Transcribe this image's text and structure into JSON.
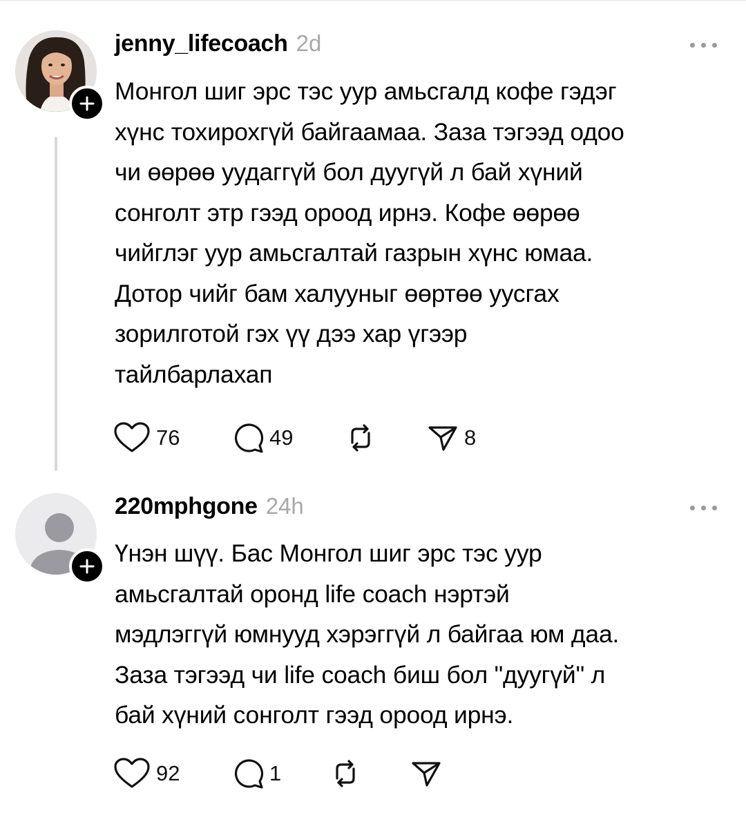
{
  "posts": [
    {
      "username": "jenny_lifecoach",
      "time": "2d",
      "text": "Монгол шиг эрс тэс уур амьсгалд кофе гэдэг\nхүнс тохирохгүй байгаамаа. Заза тэгээд одоо\nчи өөрөө уудаггүй бол дуугүй л бай хүний\nсонголт этр гээд ороод ирнэ. Кофе өөрөө\nчийглэг уур амьсгалтай газрын хүнс юмаа.\nДотор чийг бам халууныг өөртөө уусгах\nзорилготой гэх үү дээ хар үгээр\nтайлбарлахап",
      "likes": "76",
      "comments": "49",
      "reposts": "",
      "shares": "8",
      "avatar_icon": "profile-photo",
      "follow_icon": "plus-icon"
    },
    {
      "username": "220mphgone",
      "time": "24h",
      "text": "Үнэн шүү. Бас Монгол шиг эрс тэс уур\nамьсгалтай оронд life coach нэртэй\nмэдлэггүй юмнууд хэрэггүй л байгаа юм даа.\nЗаза тэгээд чи life coach биш бол \"дуугүй\" л\nбай хүний сонголт гээд ороод ирнэ.",
      "likes": "92",
      "comments": "1",
      "reposts": "",
      "shares": "",
      "avatar_icon": "default-avatar",
      "follow_icon": "plus-icon"
    }
  ],
  "colors": {
    "text": "#000000",
    "muted": "#a8a8a8",
    "divider": "#d9d9d9"
  }
}
